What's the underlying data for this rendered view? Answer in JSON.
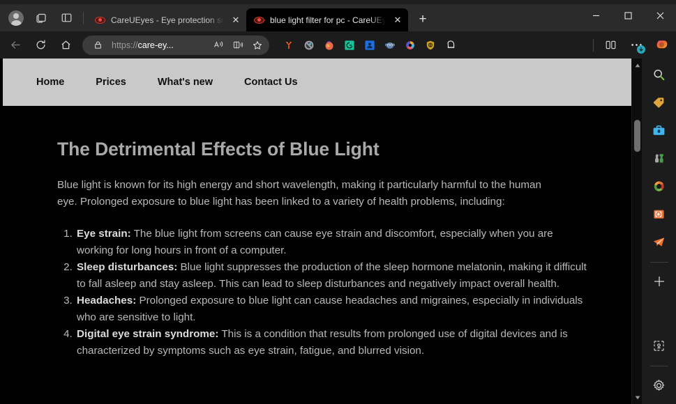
{
  "window": {
    "controls": {
      "minimize": "–",
      "maximize": "□",
      "close": "✕"
    }
  },
  "titlebar": {
    "profile_icon": "account-avatar",
    "workspaces_icon": "workspaces-icon",
    "tab_actions_icon": "tab-pane-icon",
    "new_tab_label": "+",
    "tabs": [
      {
        "title": "CareUEyes - Eye protection softw",
        "favicon": "careueyes-eye-icon",
        "close": "✕",
        "active": false
      },
      {
        "title": "blue light filter for pc - CareUEye",
        "favicon": "careueyes-eye-icon",
        "close": "✕",
        "active": true
      }
    ]
  },
  "toolbar": {
    "back": "←",
    "refresh": "refresh-icon",
    "home": "home-icon",
    "omnibox": {
      "lock_icon": "lock-icon",
      "scheme": "https://",
      "host": "care-ey...",
      "read_aloud_icon": "read-aloud-icon",
      "immersive_reader_icon": "immersive-reader-icon",
      "favorite_icon": "star-icon"
    },
    "extensions": [
      {
        "name": "yandex-extension-icon",
        "color": "#ff5c28"
      },
      {
        "name": "adblock-extension-icon",
        "color": "#9aa0a6"
      },
      {
        "name": "firefox-extension-icon",
        "color": "#e8694a"
      },
      {
        "name": "grammarly-extension-icon",
        "color": "#15c39a"
      },
      {
        "name": "lastpass-extension-icon",
        "color": "#1c6fe0"
      },
      {
        "name": "monkey-extension-icon",
        "color": "#5a7fa8"
      },
      {
        "name": "colorwheel-extension-icon",
        "color": "#d64bd6"
      },
      {
        "name": "shield-extension-icon",
        "color": "#c9a227"
      },
      {
        "name": "ghostery-extension-icon",
        "color": "#e7e7e7"
      }
    ],
    "split_screen_icon": "split-screen-icon",
    "settings_more_icon": "more-settings-icon",
    "settings_badge": "download-badge",
    "copilot_icon": "copilot-icon"
  },
  "site": {
    "nav": [
      {
        "label": "Home"
      },
      {
        "label": "Prices"
      },
      {
        "label": "What's new"
      },
      {
        "label": "Contact Us"
      }
    ],
    "heading": "The Detrimental Effects of Blue Light",
    "intro": "Blue light is known for its high energy and short wavelength, making it particularly harmful to the human eye. Prolonged exposure to blue light has been linked to a variety of health problems, including:",
    "effects": [
      {
        "term": "Eye strain:",
        "text": " The blue light from screens can cause eye strain and discomfort, especially when you are working for long hours in front of a computer."
      },
      {
        "term": "Sleep disturbances:",
        "text": " Blue light suppresses the production of the sleep hormone melatonin, making it difficult to fall asleep and stay asleep. This can lead to sleep disturbances and negatively impact overall health."
      },
      {
        "term": "Headaches:",
        "text": " Prolonged exposure to blue light can cause headaches and migraines, especially in individuals who are sensitive to light."
      },
      {
        "term": "Digital eye strain syndrome:",
        "text": " This is a condition that results from prolonged use of digital devices and is characterized by symptoms such as eye strain, fatigue, and blurred vision."
      }
    ]
  },
  "scrollbar": {
    "up_arrow": "▲",
    "down_arrow": "▼"
  },
  "sidebar": {
    "items": [
      {
        "name": "search-icon",
        "color": "#8fc93a"
      },
      {
        "name": "shopping-tag-icon",
        "color": "#e0a53a"
      },
      {
        "name": "tools-briefcase-icon",
        "color": "#3fb6f0"
      },
      {
        "name": "games-icon",
        "color": "#9aa0a6"
      },
      {
        "name": "microsoft-365-icon",
        "color": "#e8703a"
      },
      {
        "name": "outlook-icon",
        "color": "#e8703a"
      },
      {
        "name": "telegram-icon",
        "color": "#f0702a"
      }
    ],
    "add_label": "+",
    "customize_icon": "customize-sidebar-icon",
    "settings_icon": "gear-icon"
  },
  "colors": {
    "page_bg": "#000000",
    "nav_bg": "#c9c9c9",
    "body_text": "#b9b9b9",
    "heading_text": "#a9a9a9",
    "chrome_bg": "#2b2b2b"
  }
}
